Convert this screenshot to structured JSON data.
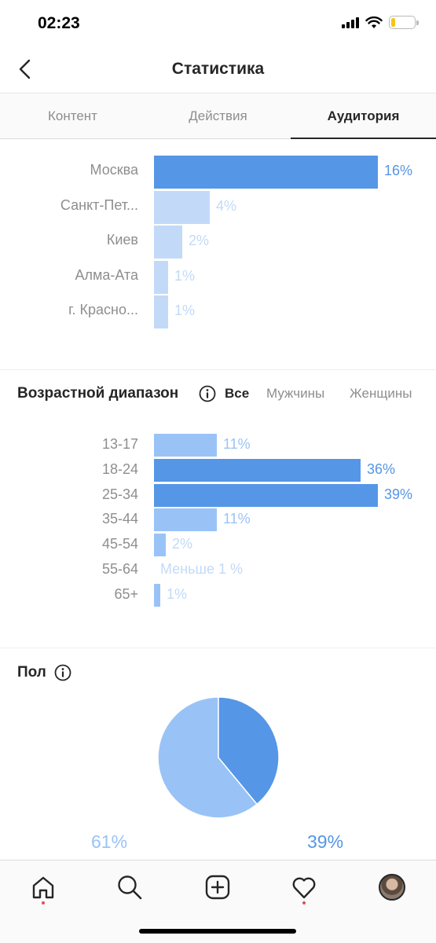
{
  "status_bar": {
    "time": "02:23",
    "battery_color": "#f5c518"
  },
  "header": {
    "title": "Статистика",
    "back_icon": "chevron-left-icon"
  },
  "tabs": [
    {
      "label": "Контент",
      "active": false
    },
    {
      "label": "Действия",
      "active": false
    },
    {
      "label": "Аудитория",
      "active": true
    }
  ],
  "colors": {
    "accent": "#5596e6",
    "accent_light": "#c2daf8",
    "accent_mid": "#99c3f7",
    "muted_text": "#8e8e8e"
  },
  "cities": {
    "items": [
      {
        "label": "Москва",
        "value": 16,
        "display": "16%"
      },
      {
        "label": "Санкт-Пет...",
        "value": 4,
        "display": "4%"
      },
      {
        "label": "Киев",
        "value": 2,
        "display": "2%"
      },
      {
        "label": "Алма-Ата",
        "value": 1,
        "display": "1%"
      },
      {
        "label": "г. Красно...",
        "value": 1,
        "display": "1%"
      }
    ]
  },
  "age": {
    "title": "Возрастной диапазон",
    "filters": [
      {
        "label": "Все",
        "active": true
      },
      {
        "label": "Мужчины",
        "active": false
      },
      {
        "label": "Женщины",
        "active": false
      }
    ],
    "items": [
      {
        "label": "13-17",
        "value": 11,
        "display": "11%"
      },
      {
        "label": "18-24",
        "value": 36,
        "display": "36%"
      },
      {
        "label": "25-34",
        "value": 39,
        "display": "39%"
      },
      {
        "label": "35-44",
        "value": 11,
        "display": "11%"
      },
      {
        "label": "45-54",
        "value": 2,
        "display": "2%"
      },
      {
        "label": "55-64",
        "value": 0,
        "display": "Меньше 1 %"
      },
      {
        "label": "65+",
        "value": 1,
        "display": "1%"
      }
    ]
  },
  "gender": {
    "title": "Пол",
    "slices": [
      {
        "value": 61,
        "display": "61%",
        "color": "#99c3f7"
      },
      {
        "value": 39,
        "display": "39%",
        "color": "#5596e6"
      }
    ]
  },
  "bottom_nav": {
    "items": [
      {
        "icon": "home-icon",
        "has_dot": true
      },
      {
        "icon": "search-icon",
        "has_dot": false
      },
      {
        "icon": "add-post-icon",
        "has_dot": false
      },
      {
        "icon": "heart-icon",
        "has_dot": true
      },
      {
        "icon": "profile-avatar",
        "has_dot": false
      }
    ]
  }
}
